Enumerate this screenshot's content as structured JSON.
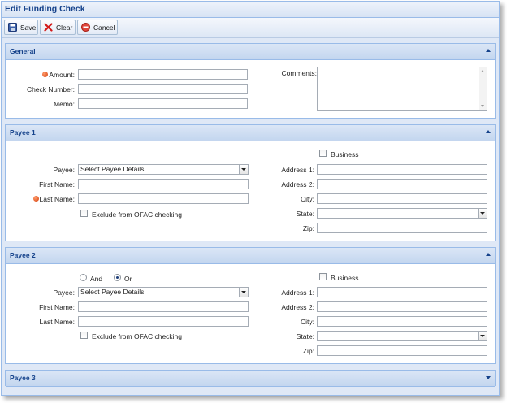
{
  "window": {
    "title": "Edit Funding Check"
  },
  "toolbar": {
    "save": "Save",
    "clear": "Clear",
    "cancel": "Cancel"
  },
  "general": {
    "title": "General",
    "amount_label": "Amount:",
    "check_number_label": "Check Number:",
    "memo_label": "Memo:",
    "comments_label": "Comments:"
  },
  "payee1": {
    "title": "Payee 1",
    "business_label": "Business",
    "payee_label": "Payee:",
    "payee_value": "Select Payee Details",
    "first_name_label": "First Name:",
    "last_name_label": "Last Name:",
    "exclude_label": "Exclude from OFAC checking",
    "address1_label": "Address 1:",
    "address2_label": "Address 2:",
    "city_label": "City:",
    "state_label": "State:",
    "zip_label": "Zip:"
  },
  "payee2": {
    "title": "Payee 2",
    "and_label": "And",
    "or_label": "Or",
    "business_label": "Business",
    "payee_label": "Payee:",
    "payee_value": "Select Payee Details",
    "first_name_label": "First Name:",
    "last_name_label": "Last Name:",
    "exclude_label": "Exclude from OFAC checking",
    "address1_label": "Address 1:",
    "address2_label": "Address 2:",
    "city_label": "City:",
    "state_label": "State:",
    "zip_label": "Zip:"
  },
  "payee3": {
    "title": "Payee 3"
  }
}
